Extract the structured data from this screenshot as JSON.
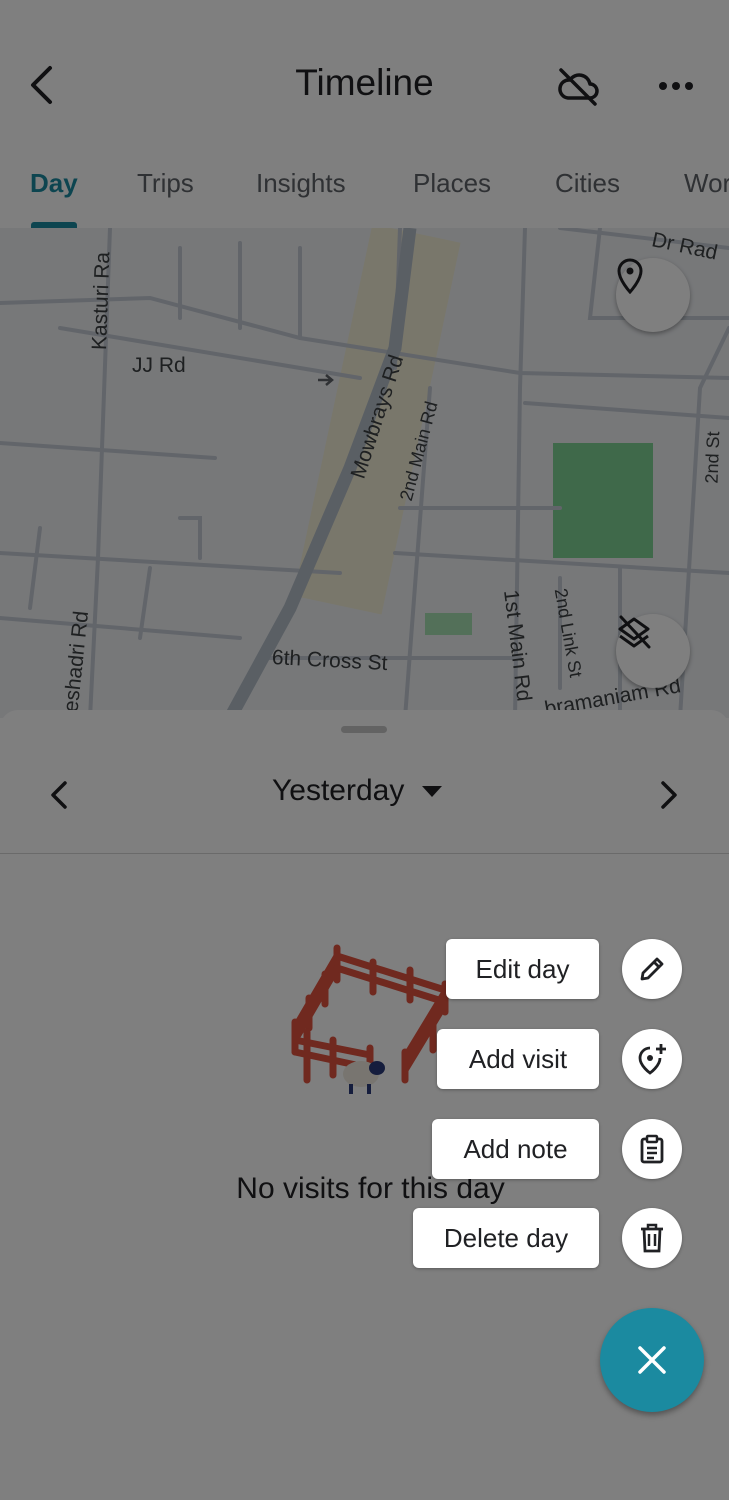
{
  "header": {
    "title": "Timeline",
    "back_icon": "arrow-back-icon",
    "sync_icon": "cloud-off-icon",
    "more_icon": "more-horizontal-icon"
  },
  "tabs": [
    {
      "label": "Day",
      "active": true
    },
    {
      "label": "Trips",
      "active": false
    },
    {
      "label": "Insights",
      "active": false
    },
    {
      "label": "Places",
      "active": false
    },
    {
      "label": "Cities",
      "active": false
    },
    {
      "label": "Wor",
      "active": false
    }
  ],
  "map": {
    "labels": {
      "kasturi": "Kasturi Ra",
      "jj": "JJ Rd",
      "mowbrays": "Mowbrays Rd",
      "second_main": "2nd Main Rd",
      "seshadri": "Seshadri Rd",
      "sixth_cross": "6th Cross St",
      "first_main": "1st Main Rd",
      "second_link": "2nd Link St",
      "subramaniam": "bramaniam Rd",
      "dr": "Dr Rad",
      "second_st": "2nd St"
    },
    "location_icon": "location-pin-icon",
    "layers_icon": "layers-off-icon"
  },
  "day": {
    "date_label": "Yesterday",
    "empty_message": "No visits for this day"
  },
  "speed_dial": {
    "items": [
      {
        "label": "Edit day",
        "icon": "pencil-icon"
      },
      {
        "label": "Add visit",
        "icon": "add-location-icon"
      },
      {
        "label": "Add note",
        "icon": "clipboard-icon"
      },
      {
        "label": "Delete day",
        "icon": "trash-icon"
      }
    ],
    "close_icon": "close-icon"
  },
  "colors": {
    "accent": "#1b8aa0",
    "scrim": "rgba(0,0,0,0.5)",
    "park": "#7ed394"
  }
}
